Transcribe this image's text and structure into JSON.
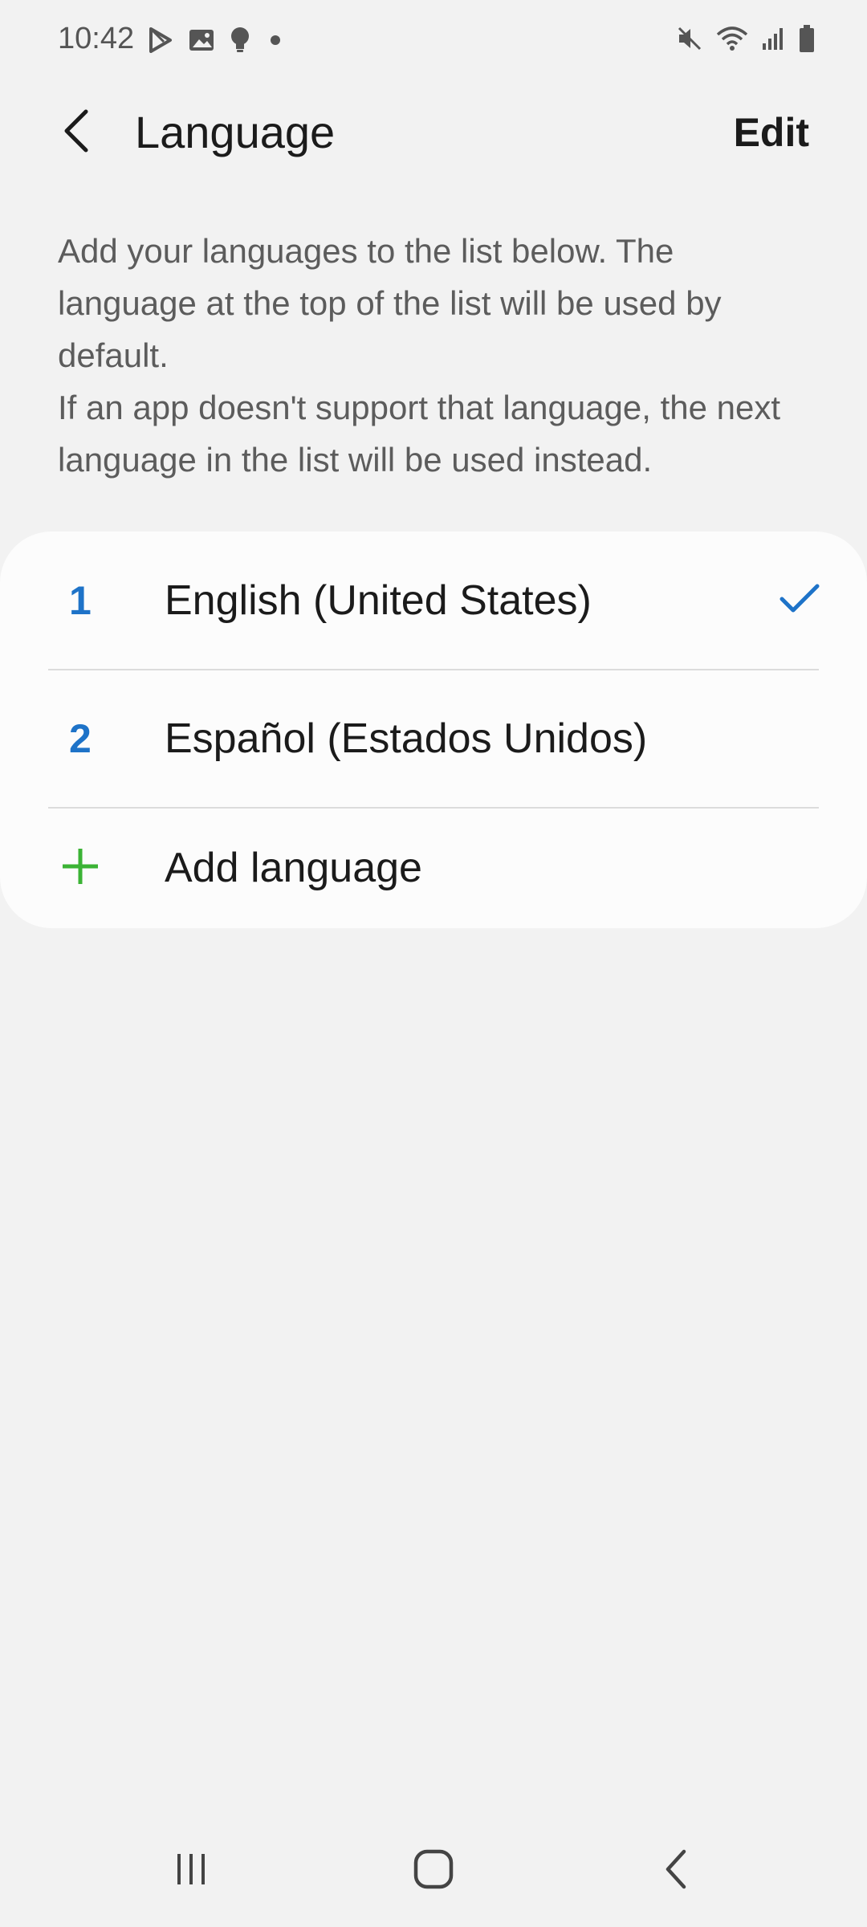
{
  "status_bar": {
    "time": "10:42",
    "left_icons": [
      "play-store-icon",
      "gallery-icon",
      "bulb-icon",
      "dot-icon"
    ],
    "right_icons": [
      "mute-icon",
      "wifi-icon",
      "signal-icon",
      "battery-icon"
    ]
  },
  "app_bar": {
    "title": "Language",
    "edit_label": "Edit"
  },
  "description": {
    "line1": "Add your languages to the list below. The language at the top of the list will be used by default.",
    "line2": "If an app doesn't support that language, the next language in the list will be used instead."
  },
  "languages": [
    {
      "index": "1",
      "label": "English (United States)",
      "selected": true
    },
    {
      "index": "2",
      "label": "Español (Estados Unidos)",
      "selected": false
    }
  ],
  "add_language_label": "Add language",
  "colors": {
    "accent_blue": "#1e73c8",
    "add_green": "#3bb335",
    "background": "#f2f2f2",
    "card": "#fcfcfc"
  },
  "nav_bar": {
    "buttons": [
      "recents-icon",
      "home-icon",
      "back-icon"
    ]
  }
}
